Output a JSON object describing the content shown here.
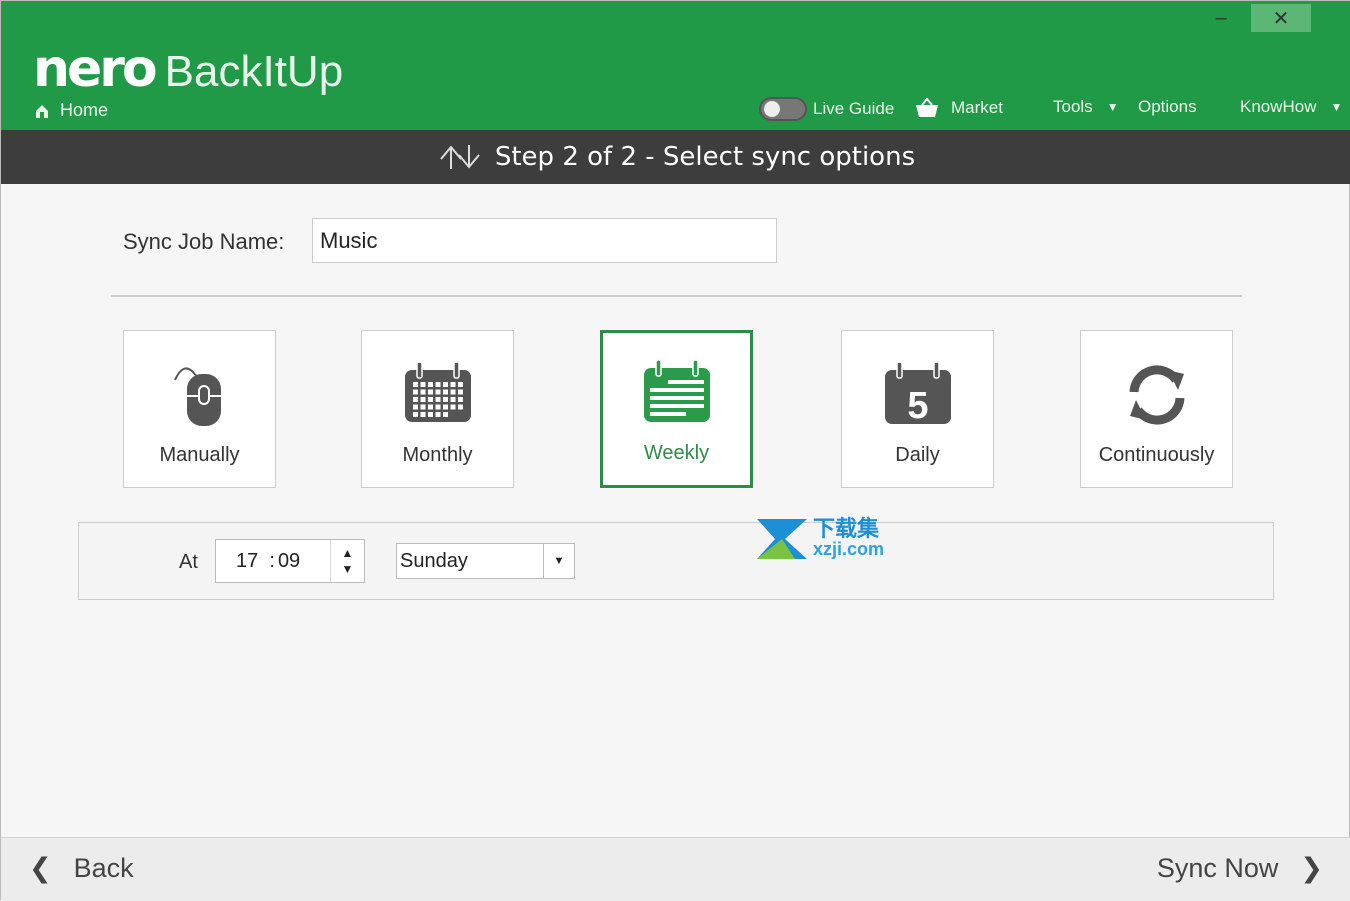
{
  "header": {
    "brand": "nero",
    "product": "BackItUp",
    "home_label": "Home",
    "nav": {
      "live_guide": "Live Guide",
      "live_guide_enabled": false,
      "market": "Market",
      "tools": "Tools",
      "options": "Options",
      "knowhow": "KnowHow"
    },
    "window": {
      "minimize": "–",
      "close": "✕"
    },
    "accent_color": "#219a48"
  },
  "step": {
    "title": "Step 2 of 2 - Select sync options"
  },
  "form": {
    "job_name_label": "Sync Job Name:",
    "job_name_value": "Music"
  },
  "options": [
    {
      "label": "Manually",
      "icon": "mouse-icon",
      "selected": false
    },
    {
      "label": "Monthly",
      "icon": "calendar-month-icon",
      "selected": false
    },
    {
      "label": "Weekly",
      "icon": "calendar-week-icon",
      "selected": true
    },
    {
      "label": "Daily",
      "icon": "calendar-day-icon",
      "selected": false
    },
    {
      "label": "Continuously",
      "icon": "refresh-icon",
      "selected": false
    }
  ],
  "daily_number": "5",
  "schedule": {
    "at_label": "At",
    "hour": "17",
    "sep": ":",
    "minute": "09",
    "day": "Sunday"
  },
  "watermark": {
    "line1": "下载集",
    "line2": "xzji.com"
  },
  "footer": {
    "back": "Back",
    "next": "Sync Now"
  }
}
